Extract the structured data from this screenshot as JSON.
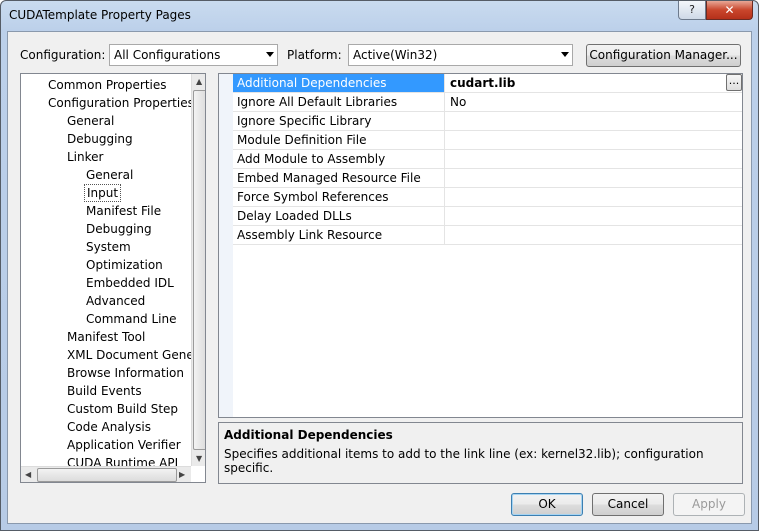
{
  "window": {
    "title": "CUDATemplate Property Pages",
    "help_glyph": "?",
    "close_glyph": "✕"
  },
  "toolbar": {
    "configuration_label": "Configuration:",
    "configuration_value": "All Configurations",
    "platform_label": "Platform:",
    "platform_value": "Active(Win32)",
    "config_manager_label": "Configuration Manager..."
  },
  "tree": {
    "items": [
      {
        "label": "Common Properties",
        "level": 0
      },
      {
        "label": "Configuration Properties",
        "level": 0
      },
      {
        "label": "General",
        "level": 1
      },
      {
        "label": "Debugging",
        "level": 1
      },
      {
        "label": "Linker",
        "level": 1
      },
      {
        "label": "General",
        "level": 2
      },
      {
        "label": "Input",
        "level": 2,
        "selected": true
      },
      {
        "label": "Manifest File",
        "level": 2
      },
      {
        "label": "Debugging",
        "level": 2
      },
      {
        "label": "System",
        "level": 2
      },
      {
        "label": "Optimization",
        "level": 2
      },
      {
        "label": "Embedded IDL",
        "level": 2
      },
      {
        "label": "Advanced",
        "level": 2
      },
      {
        "label": "Command Line",
        "level": 2
      },
      {
        "label": "Manifest Tool",
        "level": 1
      },
      {
        "label": "XML Document Genera",
        "level": 1
      },
      {
        "label": "Browse Information",
        "level": 1
      },
      {
        "label": "Build Events",
        "level": 1
      },
      {
        "label": "Custom Build Step",
        "level": 1
      },
      {
        "label": "Code Analysis",
        "level": 1
      },
      {
        "label": "Application Verifier",
        "level": 1
      },
      {
        "label": "CUDA Runtime API",
        "level": 1
      }
    ]
  },
  "grid": {
    "rows": [
      {
        "name": "Additional Dependencies",
        "value": "cudart.lib",
        "selected": true
      },
      {
        "name": "Ignore All Default Libraries",
        "value": "No"
      },
      {
        "name": "Ignore Specific Library",
        "value": ""
      },
      {
        "name": "Module Definition File",
        "value": ""
      },
      {
        "name": "Add Module to Assembly",
        "value": ""
      },
      {
        "name": "Embed Managed Resource File",
        "value": ""
      },
      {
        "name": "Force Symbol References",
        "value": ""
      },
      {
        "name": "Delay Loaded DLLs",
        "value": ""
      },
      {
        "name": "Assembly Link Resource",
        "value": ""
      }
    ],
    "ellipsis_label": "..."
  },
  "description": {
    "title": "Additional Dependencies",
    "text": "Specifies additional items to add to the link line (ex: kernel32.lib); configuration specific."
  },
  "buttons": {
    "ok": "OK",
    "cancel": "Cancel",
    "apply": "Apply"
  }
}
